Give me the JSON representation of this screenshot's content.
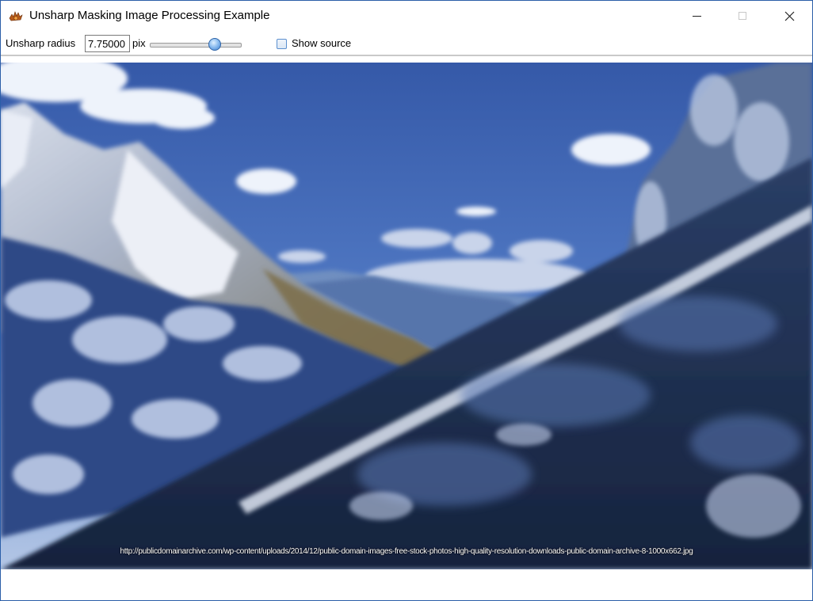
{
  "window": {
    "title": "Unsharp Masking Image Processing Example",
    "app_icon": "gear-flame-icon",
    "controls": {
      "minimize_icon": "minimize-icon",
      "maximize_icon": "maximize-icon",
      "close_icon": "close-icon",
      "close_glyph": "✕"
    }
  },
  "toolbar": {
    "radius_label": "Unsharp radius",
    "radius_value": "7.75000",
    "unit_label": "pix",
    "slider_fraction": 0.71,
    "show_source_label": "Show source",
    "show_source_checked": false
  },
  "image": {
    "caption": "http://publicdomainarchive.com/wp-content/uploads/2014/12/public-domain-images-free-stock-photos-high-quality-resolution-downloads-public-domain-archive-8-1000x662.jpg"
  },
  "colors": {
    "window_border": "#2b5ea8",
    "sky_top": "#3d64b0",
    "sky_bottom": "#9fb7de",
    "snow": "#e9eef8",
    "rock_dark": "#172640"
  }
}
